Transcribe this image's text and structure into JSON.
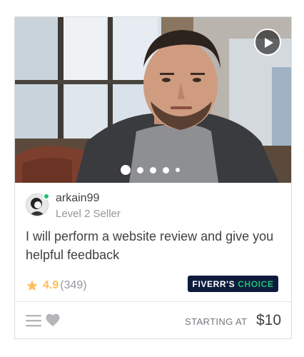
{
  "gig": {
    "seller": {
      "username": "arkain99",
      "level": "Level 2 Seller",
      "online": true
    },
    "title": "I will perform a website review and give you helpful feedback",
    "rating": {
      "score": "4.9",
      "count": "(349)"
    },
    "badge": {
      "word1": "FIVERR'S",
      "word2": "CHOICE"
    },
    "pricing": {
      "label": "STARTING AT",
      "price": "$10"
    },
    "gallery": {
      "slide_count": 5,
      "active_slide": 1
    }
  },
  "colors": {
    "brand_green": "#1dbf73",
    "rating_star": "#ffbe5b",
    "badge_bg": "#0e1b3d",
    "text_primary": "#404145",
    "text_muted": "#95979d"
  },
  "icons": {
    "play": "play-icon",
    "star": "star-icon",
    "menu": "menu-icon",
    "heart": "heart-icon"
  }
}
